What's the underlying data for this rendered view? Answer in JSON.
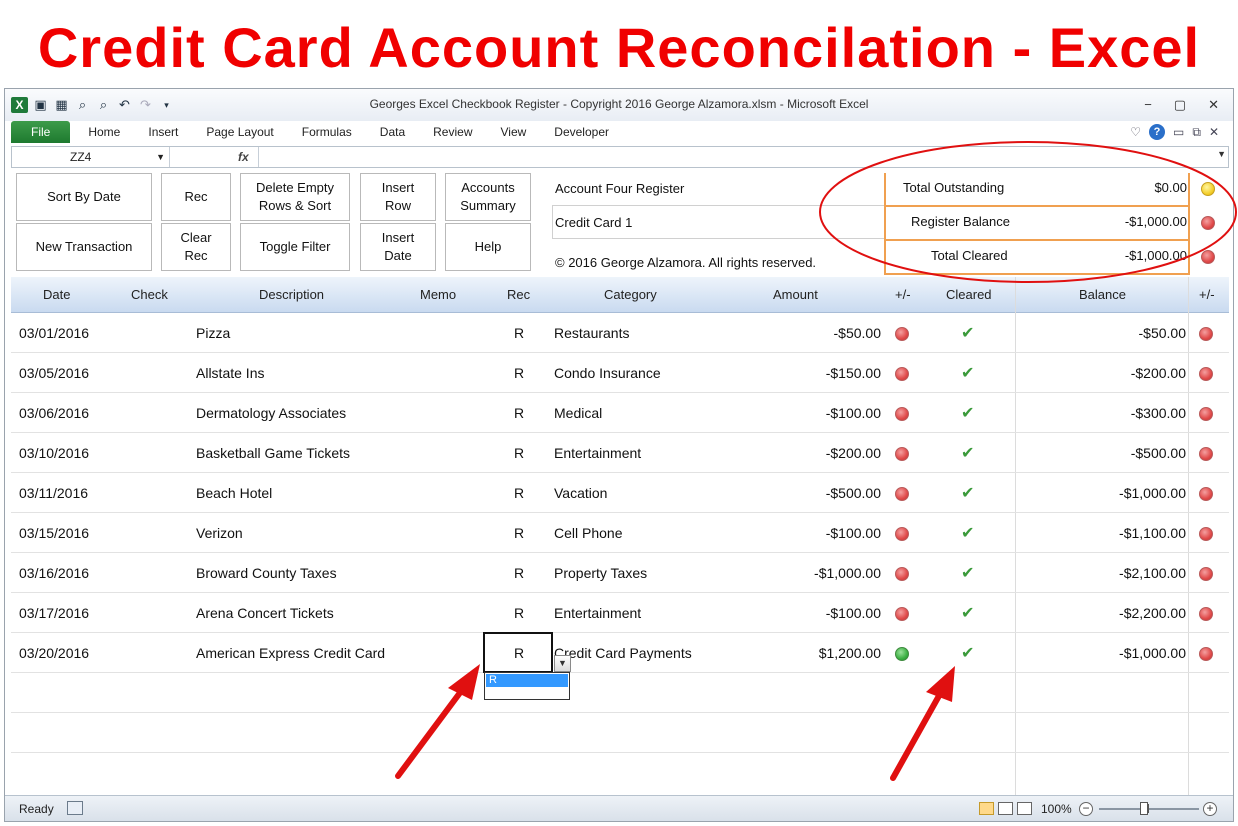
{
  "headline": "Credit Card Account Reconcilation - Excel",
  "window": {
    "title": "Georges Excel Checkbook Register - Copyright 2016 George Alzamora.xlsm  -  Microsoft Excel",
    "controls": {
      "minimize": "−",
      "restore": "▢",
      "close": "✕"
    }
  },
  "ribbon": {
    "tabs": [
      "File",
      "Home",
      "Insert",
      "Page Layout",
      "Formulas",
      "Data",
      "Review",
      "View",
      "Developer"
    ]
  },
  "formula_bar": {
    "name_box": "ZZ4",
    "fx": "fx",
    "value": ""
  },
  "buttons": {
    "sort_by_date": "Sort By Date",
    "rec": "Rec",
    "delete_empty": "Delete Empty Rows & Sort",
    "insert_row": "Insert Row",
    "accounts_summary": "Accounts Summary",
    "new_transaction": "New Transaction",
    "clear_rec": "Clear Rec",
    "toggle_filter": "Toggle Filter",
    "insert_date": "Insert Date",
    "help": "Help"
  },
  "register": {
    "name": "Account Four Register",
    "account": "Credit Card 1",
    "copyright": "© 2016 George Alzamora.  All rights reserved."
  },
  "summary": [
    {
      "label": "Total Outstanding",
      "value": "$0.00",
      "status": "yellow"
    },
    {
      "label": "Register Balance",
      "value": "-$1,000.00",
      "status": "red"
    },
    {
      "label": "Total Cleared",
      "value": "-$1,000.00",
      "status": "red"
    }
  ],
  "columns": {
    "date": "Date",
    "check": "Check",
    "description": "Description",
    "memo": "Memo",
    "rec": "Rec",
    "category": "Category",
    "amount": "Amount",
    "pm1": "+/-",
    "cleared": "Cleared",
    "balance": "Balance",
    "pm2": "+/-"
  },
  "rows": [
    {
      "date": "03/01/2016",
      "description": "Pizza",
      "rec": "R",
      "category": "Restaurants",
      "amount": "-$50.00",
      "amount_status": "red",
      "balance": "-$50.00",
      "balance_status": "red"
    },
    {
      "date": "03/05/2016",
      "description": "Allstate Ins",
      "rec": "R",
      "category": "Condo Insurance",
      "amount": "-$150.00",
      "amount_status": "red",
      "balance": "-$200.00",
      "balance_status": "red"
    },
    {
      "date": "03/06/2016",
      "description": "Dermatology Associates",
      "rec": "R",
      "category": "Medical",
      "amount": "-$100.00",
      "amount_status": "red",
      "balance": "-$300.00",
      "balance_status": "red"
    },
    {
      "date": "03/10/2016",
      "description": "Basketball Game Tickets",
      "rec": "R",
      "category": "Entertainment",
      "amount": "-$200.00",
      "amount_status": "red",
      "balance": "-$500.00",
      "balance_status": "red"
    },
    {
      "date": "03/11/2016",
      "description": "Beach Hotel",
      "rec": "R",
      "category": "Vacation",
      "amount": "-$500.00",
      "amount_status": "red",
      "balance": "-$1,000.00",
      "balance_status": "red"
    },
    {
      "date": "03/15/2016",
      "description": "Verizon",
      "rec": "R",
      "category": "Cell Phone",
      "amount": "-$100.00",
      "amount_status": "red",
      "balance": "-$1,100.00",
      "balance_status": "red"
    },
    {
      "date": "03/16/2016",
      "description": "Broward County Taxes",
      "rec": "R",
      "category": "Property Taxes",
      "amount": "-$1,000.00",
      "amount_status": "red",
      "balance": "-$2,100.00",
      "balance_status": "red"
    },
    {
      "date": "03/17/2016",
      "description": "Arena Concert Tickets",
      "rec": "R",
      "category": "Entertainment",
      "amount": "-$100.00",
      "amount_status": "red",
      "balance": "-$2,200.00",
      "balance_status": "red"
    },
    {
      "date": "03/20/2016",
      "description": "American Express Credit Card",
      "rec": "R",
      "category": "Credit Card Payments",
      "amount": "$1,200.00",
      "amount_status": "green",
      "balance": "-$1,000.00",
      "balance_status": "red"
    }
  ],
  "rec_dropdown": {
    "option": "R"
  },
  "status_bar": {
    "ready": "Ready",
    "zoom": "100%"
  },
  "colors": {
    "headline": "#f00000",
    "annotation": "#e01010",
    "summary_border": "#f0a050"
  }
}
